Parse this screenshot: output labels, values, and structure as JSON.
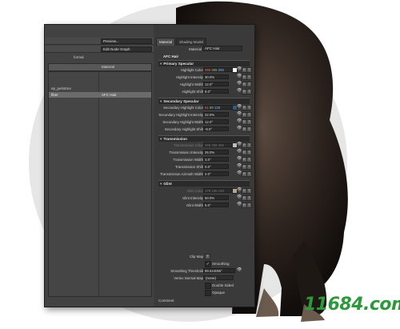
{
  "left_panel": {
    "dropdown_preview": "Preview...",
    "dropdown_edit": "Edit Node Graph",
    "small_label": "formal",
    "column_material": "Material",
    "selected_row_name": "fiber",
    "selected_row_material": "AFC Hair",
    "row_above": "ep_peristrev"
  },
  "right_panel": {
    "tabs": [
      "Material",
      "Shading Model"
    ],
    "material_label": "Material",
    "material_value": "AFC Hair",
    "node_title": "AFC Hair",
    "sections": {
      "primary": {
        "title": "Primary Specular",
        "highlight_color_label": "Highlight Color",
        "highlight_color_r": "255",
        "highlight_color_g": "255",
        "highlight_color_b": "255",
        "highlight_intensity_label": "Highlight Intensity",
        "highlight_intensity": "30.0%",
        "highlight_width_label": "Highlight Width",
        "highlight_width": "12.0°",
        "highlight_shift_label": "Highlight Shift",
        "highlight_shift": "8.0°"
      },
      "secondary": {
        "title": "Secondary Specular",
        "color_label": "Secondary Highlight Color",
        "color_r": "51",
        "color_g": "89",
        "color_b": "128",
        "intensity_label": "Secondary Highlight Intensity",
        "intensity": "22.0%",
        "width_label": "Secondary Highlight Width",
        "width": "12.0°",
        "shift_label": "Secondary Highlight Shift",
        "shift": "-8.0°"
      },
      "transmission": {
        "title": "Transmission",
        "color_label": "Transmission Color",
        "color_r": "255",
        "color_g": "255",
        "color_b": "255",
        "intensity_label": "Transmission Intensity",
        "intensity": "25.0%",
        "width_label": "Transmission Width",
        "width": "3.0°",
        "shift_label": "Transmission Shift",
        "shift": "0.0°",
        "azimuth_label": "Transmission Azimuth Width",
        "azimuth": "2.0°"
      },
      "glint": {
        "title": "Glint",
        "color_label": "Glint Color",
        "color_r": "178",
        "color_g": "165",
        "color_b": "140",
        "intensity_label": "Glint Intensity",
        "intensity": "50.0%",
        "width_label": "Glint Width",
        "width": "5.0°"
      }
    },
    "clip_map_label": "Clip Map",
    "smoothing_label": "Smoothing",
    "smoothing_threshold_label": "Smoothing Threshold",
    "smoothing_threshold": "89.524055°",
    "vertex_normal_map_label": "Vertex Normal Map",
    "vertex_normal_map_value": "(none)",
    "double_sided_label": "Double Sided",
    "opaque_label": "Opaque",
    "comment_label": "Comment"
  },
  "buttons": {
    "eye": "👁",
    "env": "E",
    "tex": "T"
  },
  "colors": {
    "primary_swatch": "#ffffff",
    "secondary_swatch": "#33597f",
    "transmission_swatch": "#ffffff",
    "glint_swatch": "#b2a58c"
  },
  "watermark": "11684.com"
}
